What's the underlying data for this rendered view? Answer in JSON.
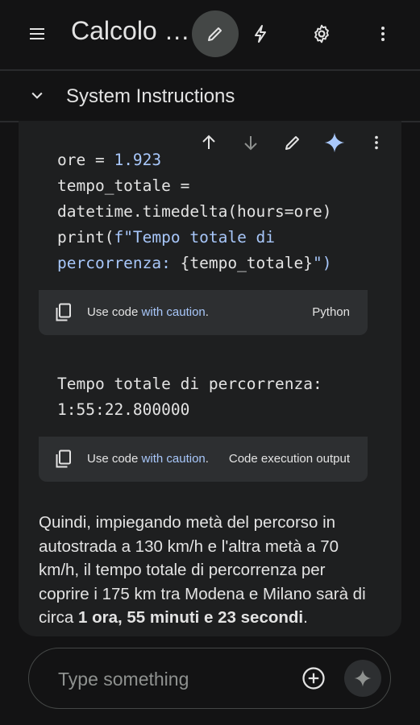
{
  "header": {
    "title": "Calcolo …",
    "icons": [
      "menu-icon",
      "edit-icon",
      "bolt-icon",
      "settings-icon",
      "more-vert-icon"
    ],
    "active_color": "#444746"
  },
  "system_instructions": {
    "label": "System Instructions",
    "icon": "chevron-down-icon"
  },
  "message_toolbar": {
    "icons": [
      "arrow-up-icon",
      "arrow-down-icon",
      "edit-icon",
      "sparkle-icon",
      "more-vert-icon"
    ]
  },
  "code_block": {
    "lines": {
      "l1a": "ore = ",
      "l1b": "1.923",
      "l2": "tempo_totale =",
      "l3": "datetime.timedelta(hours=ore)",
      "l4a": "print(",
      "l4b": "f\"Tempo totale di",
      "l5a": "percorrenza: ",
      "l5b": "{tempo_totale}",
      "l5c": "\")"
    },
    "footer": {
      "use_code": "Use code ",
      "caution": "with caution",
      "period": ".",
      "language": "Python"
    }
  },
  "output_block": {
    "lines": {
      "l1": "Tempo totale di percorrenza:",
      "l2": "1:55:22.800000"
    },
    "footer": {
      "use_code": "Use code ",
      "caution": "with caution",
      "period": ".",
      "language": "Code execution output"
    }
  },
  "answer": {
    "text": "Quindi, impiegando metà del percorso in autostrada a 130 km/h e l'altra metà a 70 km/h, il tempo totale di percorrenza per coprire i 175 km tra Modena e Milano sarà di circa ",
    "bold": "1 ora, 55 minuti e 23 secondi",
    "end": "."
  },
  "composer": {
    "placeholder": "Type something",
    "add_icon": "add-circle-icon",
    "send_icon": "sparkle-icon"
  },
  "colors": {
    "background": "#131314",
    "surface": "#1e1f20",
    "accent": "#a8c7fa",
    "sparkle": "#a8c7fa"
  }
}
